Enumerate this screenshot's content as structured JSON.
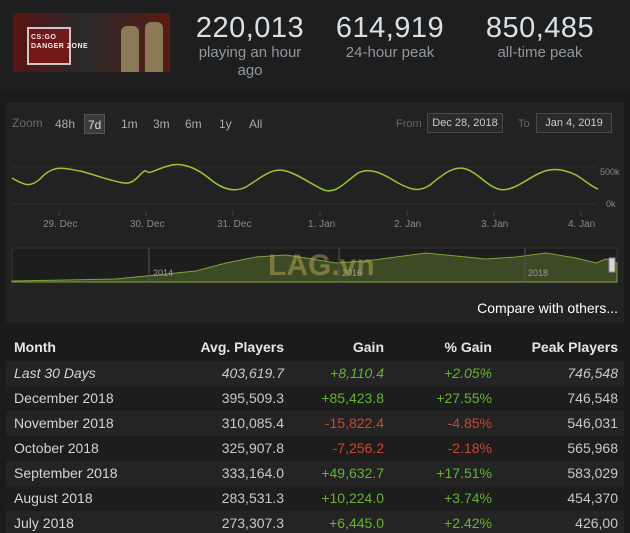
{
  "header": {
    "game_logo_text_1": "CS:GO",
    "game_logo_text_2": "DANGER ZONE",
    "stats": [
      {
        "value": "220,013",
        "label": "playing an hour ago"
      },
      {
        "value": "614,919",
        "label": "24-hour peak"
      },
      {
        "value": "850,485",
        "label": "all-time peak"
      }
    ]
  },
  "chart_controls": {
    "zoom_label": "Zoom",
    "zoom_options": [
      "48h",
      "7d",
      "1m",
      "3m",
      "6m",
      "1y",
      "All"
    ],
    "active_zoom": "7d",
    "from_label": "From",
    "from_date": "Dec 28, 2018",
    "to_label": "To",
    "to_date": "Jan 4, 2019"
  },
  "chart_data": {
    "type": "line",
    "x_ticks": [
      "29. Dec",
      "30. Dec",
      "31. Dec",
      "1. Jan",
      "2. Jan",
      "3. Jan",
      "4. Jan"
    ],
    "y_ticks": [
      "500k",
      "0k"
    ],
    "navigator_ticks": [
      "2014",
      "2016",
      "2018"
    ],
    "series_color": "#9ac534",
    "watermark": "LAG.vn"
  },
  "compare_link": "Compare with others...",
  "table": {
    "headers": [
      "Month",
      "Avg. Players",
      "Gain",
      "% Gain",
      "Peak Players"
    ],
    "rows": [
      {
        "month": "Last 30 Days",
        "avg": "403,619.7",
        "gain": "+8,110.4",
        "pct": "+2.05%",
        "peak": "746,548",
        "sign": "pos",
        "italic": true
      },
      {
        "month": "December 2018",
        "avg": "395,509.3",
        "gain": "+85,423.8",
        "pct": "+27.55%",
        "peak": "746,548",
        "sign": "pos"
      },
      {
        "month": "November 2018",
        "avg": "310,085.4",
        "gain": "-15,822.4",
        "pct": "-4.85%",
        "peak": "546,031",
        "sign": "neg"
      },
      {
        "month": "October 2018",
        "avg": "325,907.8",
        "gain": "-7,256.2",
        "pct": "-2.18%",
        "peak": "565,968",
        "sign": "neg"
      },
      {
        "month": "September 2018",
        "avg": "333,164.0",
        "gain": "+49,632.7",
        "pct": "+17.51%",
        "peak": "583,029",
        "sign": "pos"
      },
      {
        "month": "August 2018",
        "avg": "283,531.3",
        "gain": "+10,224.0",
        "pct": "+3.74%",
        "peak": "454,370",
        "sign": "pos"
      },
      {
        "month": "July 2018",
        "avg": "273,307.3",
        "gain": "+6,445.0",
        "pct": "+2.42%",
        "peak": "426,00",
        "sign": "pos"
      }
    ]
  }
}
